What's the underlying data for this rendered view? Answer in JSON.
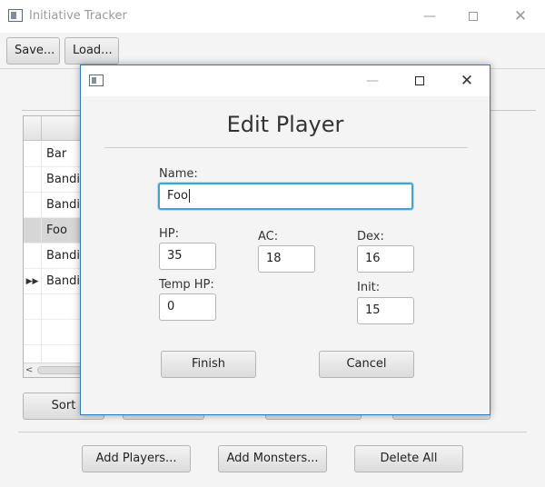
{
  "window": {
    "title": "Initiative Tracker"
  },
  "toolbar": {
    "save_label": "Save...",
    "load_label": "Load..."
  },
  "tracker": {
    "rows": [
      {
        "name": "Bar",
        "current": false,
        "selected": false
      },
      {
        "name": "Bandit",
        "current": false,
        "selected": false
      },
      {
        "name": "Bandit",
        "current": false,
        "selected": false
      },
      {
        "name": "Foo",
        "current": false,
        "selected": true
      },
      {
        "name": "Bandit",
        "current": false,
        "selected": false
      },
      {
        "name": "Bandit",
        "current": true,
        "selected": false
      }
    ],
    "current_marker": "▶▶",
    "scroll_left_arrow": "<",
    "sort_label": "Sort"
  },
  "bottom_buttons": {
    "add_players": "Add Players...",
    "add_monsters": "Add Monsters...",
    "delete_all": "Delete All"
  },
  "dialog": {
    "heading": "Edit Player",
    "name_label": "Name:",
    "name_value": "Foo",
    "hp_label": "HP:",
    "hp_value": "35",
    "ac_label": "AC:",
    "ac_value": "18",
    "dex_label": "Dex:",
    "dex_value": "16",
    "temp_hp_label": "Temp HP:",
    "temp_hp_value": "0",
    "init_label": "Init:",
    "init_value": "15",
    "finish_label": "Finish",
    "cancel_label": "Cancel"
  },
  "colors": {
    "accent": "#3ea5d8",
    "dialog_border": "#2b79c2"
  }
}
